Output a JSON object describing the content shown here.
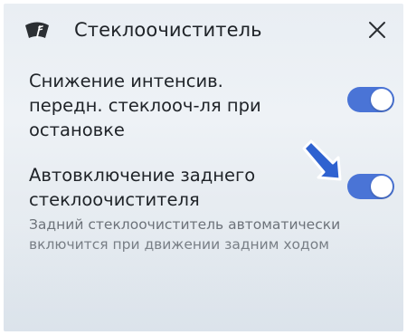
{
  "header": {
    "title": "Стеклоочиститель",
    "icon": "windshield-wiper-icon",
    "close_icon": "close-icon"
  },
  "settings": [
    {
      "lines": [
        "Снижение интенсив.",
        "передн. стеклооч-ля при",
        "остановке"
      ],
      "enabled": true
    },
    {
      "lines": [
        "Автовключение заднего",
        "стеклоочистителя"
      ],
      "description_lines": [
        "Задний стеклоочиститель автоматически",
        "включится при движении задним ходом"
      ],
      "enabled": true
    }
  ],
  "colors": {
    "toggle_on": "#4a74d6",
    "arrow": "#2f62d0"
  },
  "annotation": {
    "icon": "pointer-arrow-icon"
  }
}
